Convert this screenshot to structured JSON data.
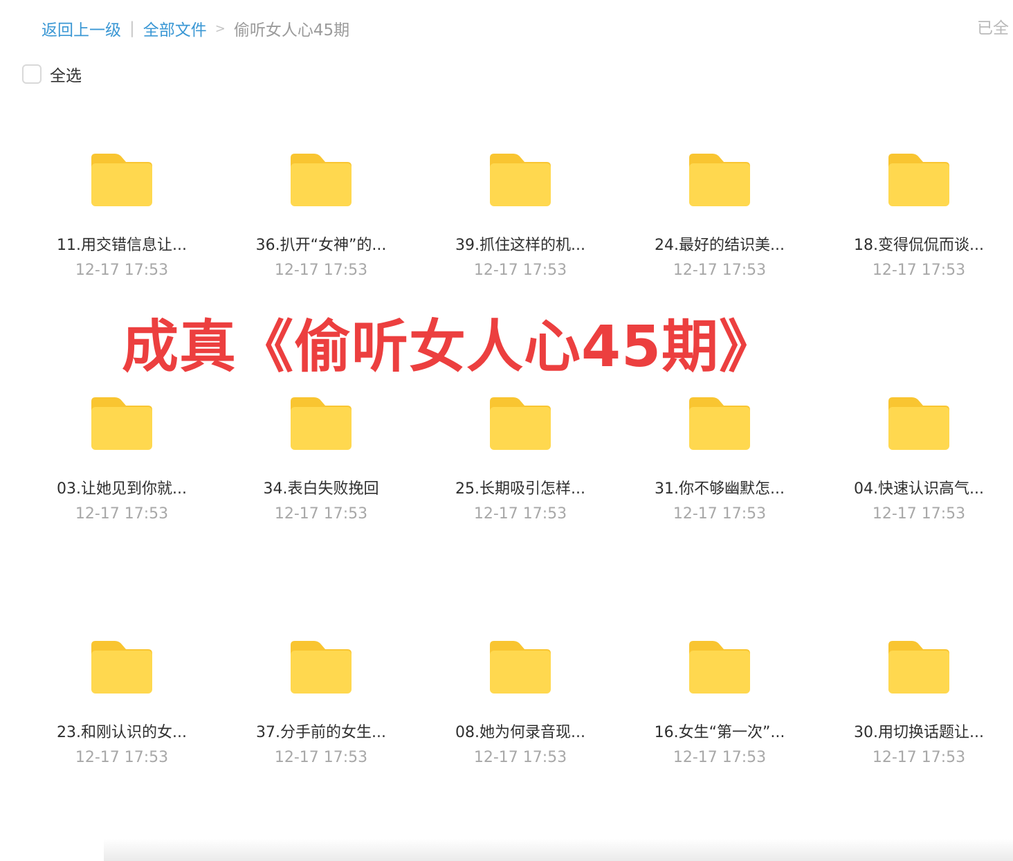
{
  "breadcrumb": {
    "back": "返回上一级",
    "separator": "|",
    "all_files": "全部文件",
    "arrow": ">",
    "current": "偷听女人心45期"
  },
  "top_right_text": "已全",
  "select_all": {
    "label": "全选",
    "checked": false
  },
  "watermark": "成真《偷听女人心45期》",
  "colors": {
    "link": "#3a97d4",
    "folder_main": "#ffd84f",
    "folder_tab": "#f9c531",
    "watermark": "#ec3f3f"
  },
  "folders": [
    {
      "name": "11.用交错信息让...",
      "time": "12-17 17:53",
      "icon": "folder-icon"
    },
    {
      "name": "36.扒开“女神”的...",
      "time": "12-17 17:53",
      "icon": "folder-icon"
    },
    {
      "name": "39.抓住这样的机...",
      "time": "12-17 17:53",
      "icon": "folder-icon"
    },
    {
      "name": "24.最好的结识美...",
      "time": "12-17 17:53",
      "icon": "folder-icon"
    },
    {
      "name": "18.变得侃侃而谈...",
      "time": "12-17 17:53",
      "icon": "folder-icon"
    },
    {
      "name": "03.让她见到你就...",
      "time": "12-17 17:53",
      "icon": "folder-icon"
    },
    {
      "name": "34.表白失败挽回",
      "time": "12-17 17:53",
      "icon": "folder-icon"
    },
    {
      "name": "25.长期吸引怎样...",
      "time": "12-17 17:53",
      "icon": "folder-icon"
    },
    {
      "name": "31.你不够幽默怎...",
      "time": "12-17 17:53",
      "icon": "folder-icon"
    },
    {
      "name": "04.快速认识高气...",
      "time": "12-17 17:53",
      "icon": "folder-icon"
    },
    {
      "name": "23.和刚认识的女...",
      "time": "12-17 17:53",
      "icon": "folder-icon"
    },
    {
      "name": "37.分手前的女生...",
      "time": "12-17 17:53",
      "icon": "folder-icon"
    },
    {
      "name": "08.她为何录音现...",
      "time": "12-17 17:53",
      "icon": "folder-icon"
    },
    {
      "name": "16.女生“第一次”...",
      "time": "12-17 17:53",
      "icon": "folder-icon"
    },
    {
      "name": "30.用切换话题让...",
      "time": "12-17 17:53",
      "icon": "folder-icon"
    }
  ]
}
